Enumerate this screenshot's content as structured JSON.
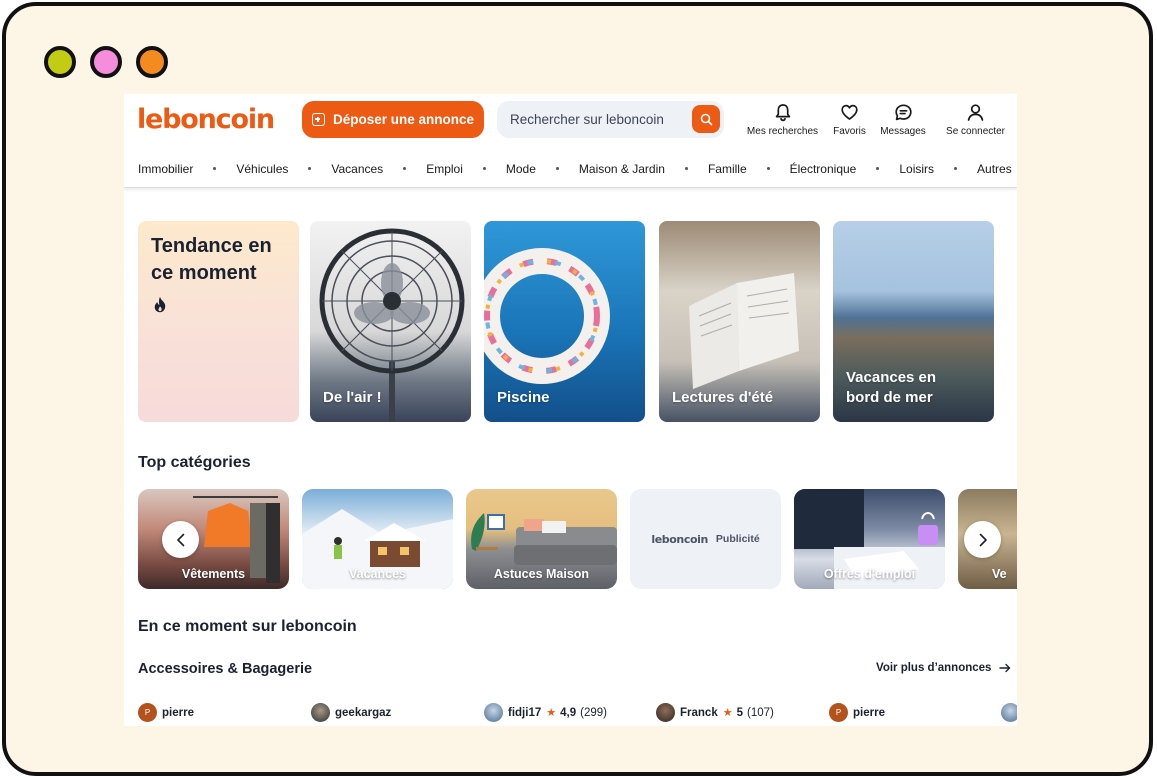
{
  "window": {
    "controls": [
      "window-dot-1",
      "window-dot-2",
      "window-dot-3"
    ]
  },
  "header": {
    "logo": "leboncoin",
    "deposit_label": "Déposer une annonce",
    "search_placeholder": "Rechercher sur leboncoin",
    "nav": [
      {
        "label": "Mes recherches",
        "icon": "bell-icon"
      },
      {
        "label": "Favoris",
        "icon": "heart-icon"
      },
      {
        "label": "Messages",
        "icon": "chat-icon"
      },
      {
        "label": "Se connecter",
        "icon": "user-icon"
      }
    ]
  },
  "categories_nav": [
    "Immobilier",
    "Véhicules",
    "Vacances",
    "Emploi",
    "Mode",
    "Maison & Jardin",
    "Famille",
    "Électronique",
    "Loisirs",
    "Autres"
  ],
  "trending": {
    "title": "Tendance en ce moment",
    "cards": [
      "De l'air !",
      "Piscine",
      "Lectures d'été",
      "Vacances en bord de mer"
    ]
  },
  "top_categories": {
    "title": "Top catégories",
    "cards": [
      "Vêtements",
      "Vacances",
      "Astuces Maison",
      "Offres d'emploi",
      "Ve"
    ],
    "ad": {
      "logo": "leboncoin",
      "label": "Publicité"
    }
  },
  "moment": {
    "title": "En ce moment sur leboncoin",
    "subtitle": "Accessoires & Bagagerie",
    "more_link": "Voir plus d’annonces",
    "sellers": [
      {
        "initial": "P",
        "name": "pierre"
      },
      {
        "name": "geekargaz"
      },
      {
        "name": "fidji17",
        "rating": "4,9",
        "count": "(299)"
      },
      {
        "name": "Franck",
        "rating": "5",
        "count": "(107)"
      },
      {
        "initial": "P",
        "name": "pierre"
      }
    ]
  },
  "colors": {
    "brand": "#ec5a13",
    "frame_bg": "#fdf5e6",
    "text": "#1a2130"
  }
}
